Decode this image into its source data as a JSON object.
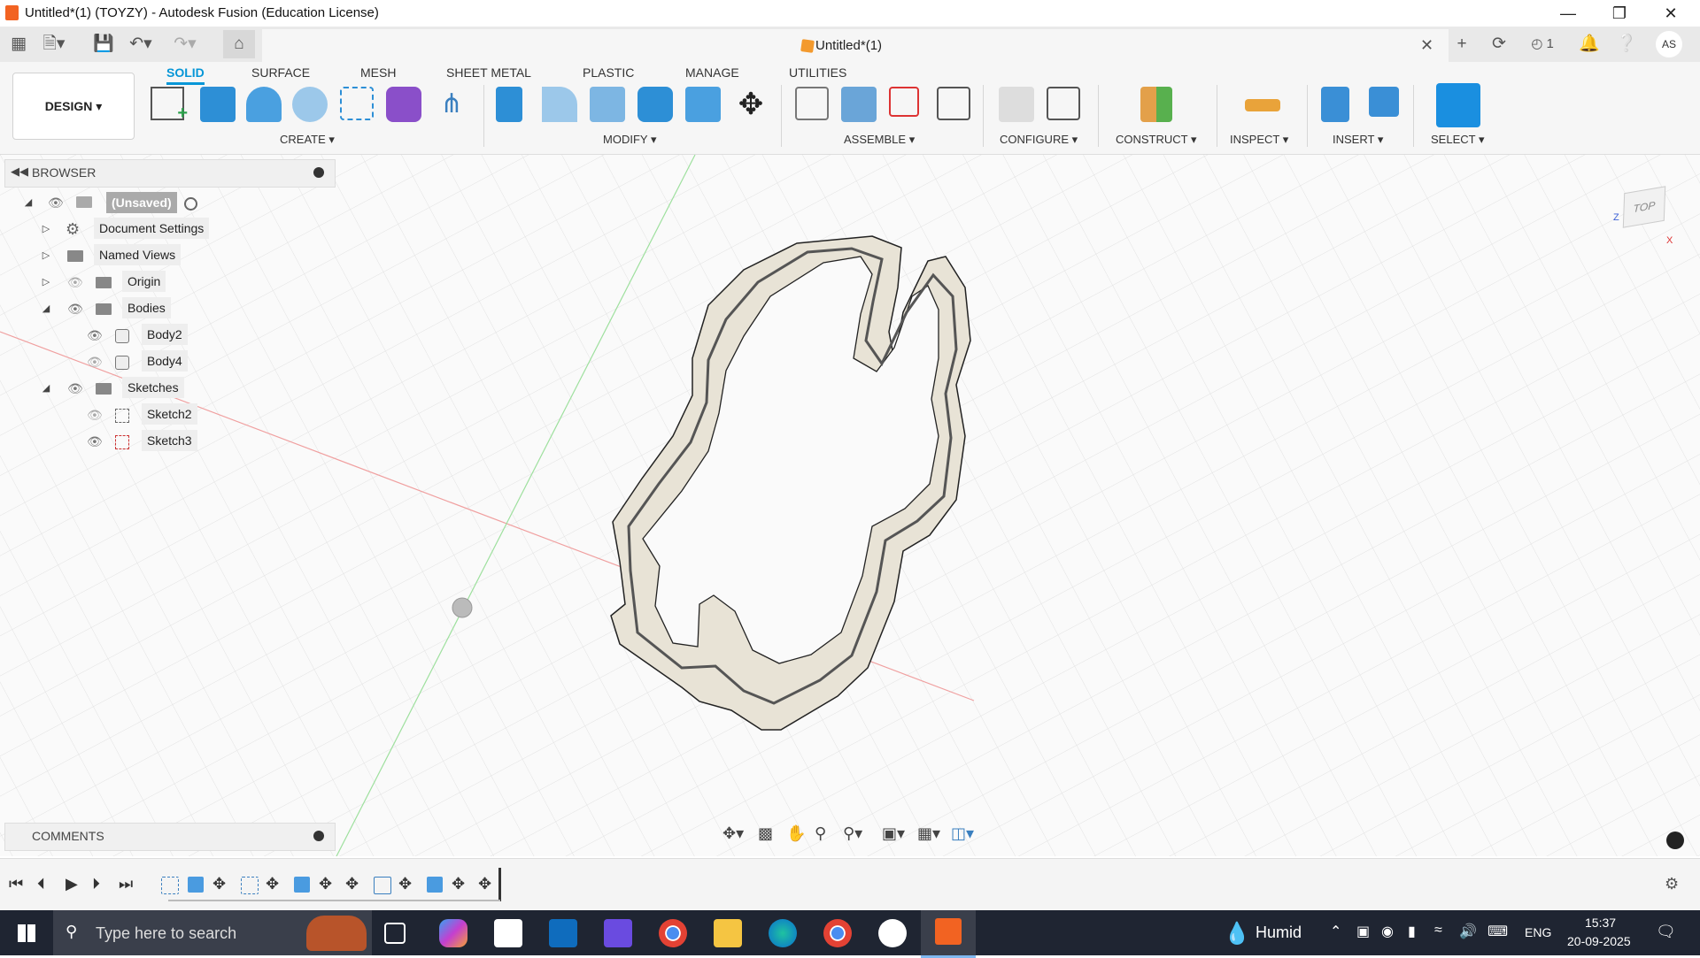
{
  "window": {
    "title": "Untitled*(1) (TOYZY) - Autodesk Fusion (Education License)"
  },
  "appbar": {
    "doc_tab_title": "Untitled*(1)",
    "jobs_count": "1",
    "user_initials": "AS"
  },
  "ribbon": {
    "workspace": "DESIGN",
    "tabs": [
      "SOLID",
      "SURFACE",
      "MESH",
      "SHEET METAL",
      "PLASTIC",
      "MANAGE",
      "UTILITIES"
    ],
    "groups": [
      "CREATE",
      "MODIFY",
      "ASSEMBLE",
      "CONFIGURE",
      "CONSTRUCT",
      "INSPECT",
      "INSERT",
      "SELECT"
    ]
  },
  "browser": {
    "title": "BROWSER",
    "root": "(Unsaved)",
    "items": [
      "Document Settings",
      "Named Views",
      "Origin",
      "Bodies",
      "Body2",
      "Body4",
      "Sketches",
      "Sketch2",
      "Sketch3"
    ]
  },
  "comments": {
    "title": "COMMENTS"
  },
  "viewcube": {
    "label": "TOP"
  },
  "taskbar": {
    "search_placeholder": "Type here to search",
    "weather": "Humid",
    "language": "ENG",
    "time": "15:37",
    "date": "20-09-2025"
  },
  "colors": {
    "accent": "#0696d7",
    "fusion_orange": "#f26322"
  }
}
